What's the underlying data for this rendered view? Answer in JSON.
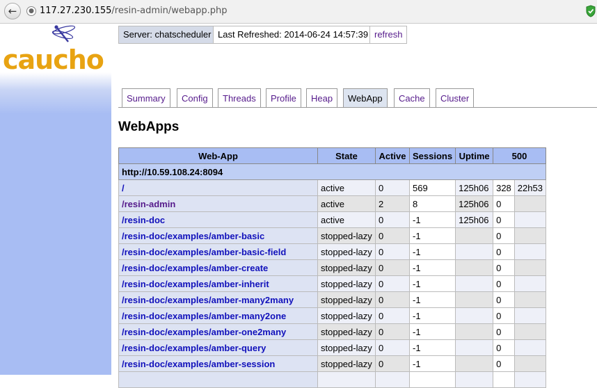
{
  "browser": {
    "url_host": "117.27.230.155",
    "url_path": "/resin-admin/webapp.php"
  },
  "logo": {
    "text": "caucho"
  },
  "header": {
    "server": "Server: chatscheduler",
    "last_refreshed": "Last Refreshed: 2014-06-24 14:57:39",
    "refresh_link": "refresh"
  },
  "tabs": [
    {
      "label": "Summary"
    },
    {
      "label": "Config"
    },
    {
      "label": "Threads"
    },
    {
      "label": "Profile"
    },
    {
      "label": "Heap"
    },
    {
      "label": "WebApp",
      "active": true
    },
    {
      "label": "Cache"
    },
    {
      "label": "Cluster"
    }
  ],
  "page_title": "WebApps",
  "table": {
    "headers": [
      "Web-App",
      "State",
      "Active",
      "Sessions",
      "Uptime",
      "500"
    ],
    "host": "http://10.59.108.24:8094",
    "rows": [
      {
        "name": "/",
        "state": "active",
        "active": "0",
        "sessions": "569",
        "uptime": "125h06",
        "err": "328",
        "last": "22h53"
      },
      {
        "name": "/resin-admin",
        "state": "active",
        "active": "2",
        "sessions": "8",
        "uptime": "125h06",
        "err": "0",
        "last": ""
      },
      {
        "name": "/resin-doc",
        "state": "active",
        "active": "0",
        "sessions": "-1",
        "uptime": "125h06",
        "err": "0",
        "last": ""
      },
      {
        "name": "/resin-doc/examples/amber-basic",
        "state": "stopped-lazy",
        "active": "0",
        "sessions": "-1",
        "uptime": "",
        "err": "0",
        "last": ""
      },
      {
        "name": "/resin-doc/examples/amber-basic-field",
        "state": "stopped-lazy",
        "active": "0",
        "sessions": "-1",
        "uptime": "",
        "err": "0",
        "last": ""
      },
      {
        "name": "/resin-doc/examples/amber-create",
        "state": "stopped-lazy",
        "active": "0",
        "sessions": "-1",
        "uptime": "",
        "err": "0",
        "last": ""
      },
      {
        "name": "/resin-doc/examples/amber-inherit",
        "state": "stopped-lazy",
        "active": "0",
        "sessions": "-1",
        "uptime": "",
        "err": "0",
        "last": ""
      },
      {
        "name": "/resin-doc/examples/amber-many2many",
        "state": "stopped-lazy",
        "active": "0",
        "sessions": "-1",
        "uptime": "",
        "err": "0",
        "last": ""
      },
      {
        "name": "/resin-doc/examples/amber-many2one",
        "state": "stopped-lazy",
        "active": "0",
        "sessions": "-1",
        "uptime": "",
        "err": "0",
        "last": ""
      },
      {
        "name": "/resin-doc/examples/amber-one2many",
        "state": "stopped-lazy",
        "active": "0",
        "sessions": "-1",
        "uptime": "",
        "err": "0",
        "last": ""
      },
      {
        "name": "/resin-doc/examples/amber-query",
        "state": "stopped-lazy",
        "active": "0",
        "sessions": "-1",
        "uptime": "",
        "err": "0",
        "last": ""
      },
      {
        "name": "/resin-doc/examples/amber-session",
        "state": "stopped-lazy",
        "active": "0",
        "sessions": "-1",
        "uptime": "",
        "err": "0",
        "last": ""
      },
      {
        "name": "",
        "state": "",
        "active": "",
        "sessions": "",
        "uptime": "",
        "err": "",
        "last": ""
      }
    ]
  }
}
